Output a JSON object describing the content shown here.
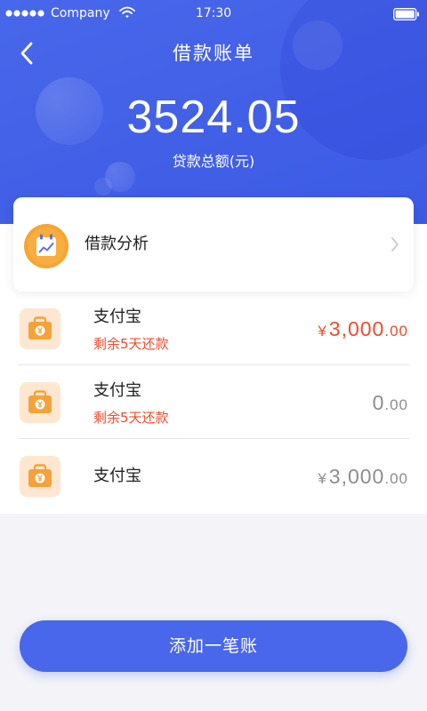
{
  "status_bar": {
    "carrier": "Company",
    "time": "17:30"
  },
  "header": {
    "title": "借款账单",
    "total_amount": "3524.05",
    "total_label": "贷款总额(元)"
  },
  "analysis_card": {
    "label": "借款分析"
  },
  "loans": [
    {
      "name": "支付宝",
      "note": "剩余5天还款",
      "currency": "¥",
      "whole": "3,000",
      "cents": ".00"
    },
    {
      "name": "支付宝",
      "note": "剩余5天还款",
      "whole": "0",
      "cents": ".00"
    },
    {
      "name": "支付宝",
      "currency": "¥",
      "whole": "3,000",
      "cents": ".00"
    }
  ],
  "add_button": {
    "label": "添加一笔账"
  },
  "icons": {
    "signal": "signal-icon",
    "wifi": "wifi-icon",
    "battery": "battery-icon",
    "back": "chevron-left-icon",
    "analysis": "chart-calendar-icon",
    "analysis_arrow": "chevron-right-icon",
    "loan": "wallet-icon"
  },
  "colors": {
    "primary": "#4867ea",
    "due": "#ef4b2d",
    "orange": "#f6a533",
    "icon_bg": "#fde7d1",
    "muted": "#8d8d8d"
  }
}
